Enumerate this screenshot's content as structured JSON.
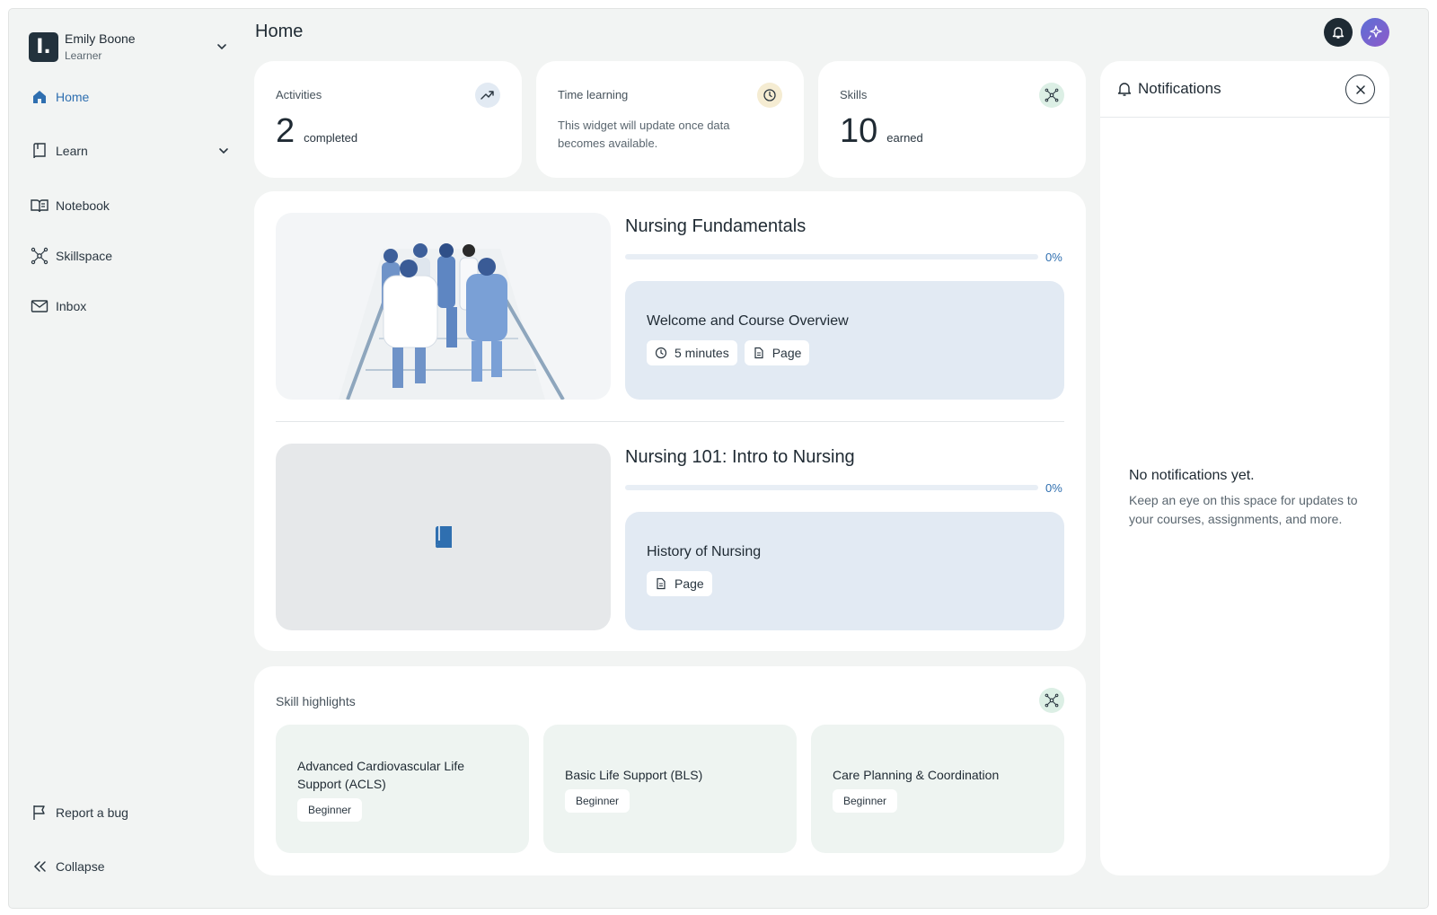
{
  "user": {
    "initial": "I.",
    "name": "Emily Boone",
    "role": "Learner"
  },
  "nav": {
    "items": [
      {
        "label": "Home",
        "icon": "home-icon",
        "active": true
      },
      {
        "label": "Learn",
        "icon": "book-icon"
      },
      {
        "label": "Notebook",
        "icon": "open-book-icon"
      },
      {
        "label": "Skillspace",
        "icon": "network-icon"
      },
      {
        "label": "Inbox",
        "icon": "mail-icon"
      }
    ],
    "report_bug": "Report a bug",
    "collapse": "Collapse"
  },
  "header": {
    "title": "Home"
  },
  "stats": {
    "activities": {
      "label": "Activities",
      "value": "2",
      "unit": "completed"
    },
    "time": {
      "label": "Time learning",
      "message": "This widget will update once data becomes available."
    },
    "skills": {
      "label": "Skills",
      "value": "10",
      "unit": "earned"
    }
  },
  "courses": [
    {
      "title": "Nursing Fundamentals",
      "progress": 0,
      "progress_label": "0%",
      "next_activity": {
        "title": "Welcome and Course Overview",
        "duration": "5 minutes",
        "type": "Page"
      }
    },
    {
      "title": "Nursing 101: Intro to Nursing",
      "progress": 0,
      "progress_label": "0%",
      "next_activity": {
        "title": "History of Nursing",
        "type": "Page"
      }
    }
  ],
  "skill_highlights": {
    "label": "Skill highlights",
    "items": [
      {
        "name": "Advanced Cardiovascular Life Support (ACLS)",
        "level": "Beginner"
      },
      {
        "name": "Basic Life Support (BLS)",
        "level": "Beginner"
      },
      {
        "name": "Care Planning & Coordination",
        "level": "Beginner"
      }
    ]
  },
  "notifications": {
    "title": "Notifications",
    "empty_title": "No notifications yet.",
    "empty_message": "Keep an eye on this space for updates to your courses, assignments, and more."
  },
  "colors": {
    "accent": "#2f6fb0",
    "dark": "#1e2a33",
    "activity_bg": "#e2eaf3",
    "skill_bg": "#eef4f1"
  }
}
